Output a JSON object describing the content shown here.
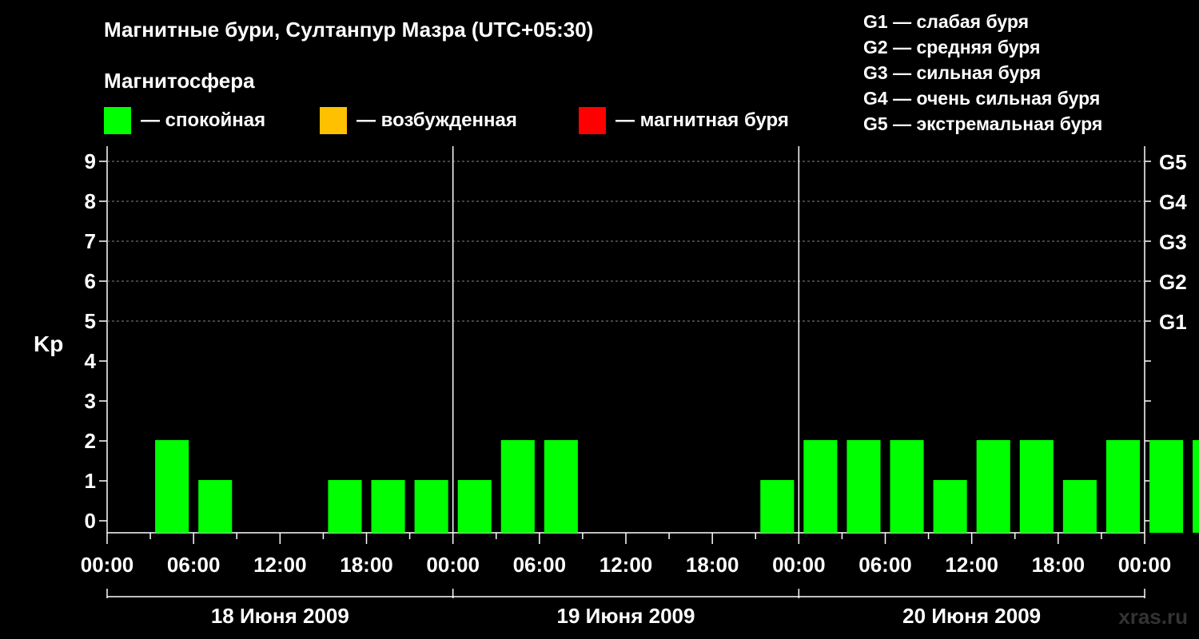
{
  "title": "Магнитные бури, Султанпур Мазра (UTC+05:30)",
  "subtitle": "Магнитосфера",
  "legend": [
    {
      "label": "— спокойная",
      "color": "#00ff00"
    },
    {
      "label": "— возбужденная",
      "color": "#ffc000"
    },
    {
      "label": "— магнитная буря",
      "color": "#ff0000"
    }
  ],
  "g_legend": [
    "G1 — слабая буря",
    "G2 — средняя буря",
    "G3 — сильная буря",
    "G4 — очень сильная буря",
    "G5 — экстремальная буря"
  ],
  "watermark": "xras.ru",
  "chart_data": {
    "type": "bar",
    "ylabel": "Kp",
    "ylim": [
      0,
      9
    ],
    "yticks": [
      "0",
      "1",
      "2",
      "3",
      "4",
      "5",
      "6",
      "7",
      "8",
      "9"
    ],
    "right_ticks": [
      {
        "level": 5,
        "label": "G1"
      },
      {
        "level": 6,
        "label": "G2"
      },
      {
        "level": 7,
        "label": "G3"
      },
      {
        "level": 8,
        "label": "G4"
      },
      {
        "level": 9,
        "label": "G5"
      }
    ],
    "xtick_labels": [
      "00:00",
      "06:00",
      "12:00",
      "18:00",
      "00:00",
      "06:00",
      "12:00",
      "18:00",
      "00:00",
      "06:00",
      "12:00",
      "18:00",
      "00:00"
    ],
    "days": [
      "18 Июня 2009",
      "19 Июня 2009",
      "20 Июня 2009"
    ],
    "interval_hours": 3,
    "start": "18 Июня 2009 00:00",
    "series": [
      {
        "values": [
          0,
          2,
          1,
          0,
          0,
          1,
          1,
          1,
          1,
          2,
          2,
          0,
          0,
          0,
          0,
          1,
          2,
          2,
          2,
          1,
          2,
          2,
          1,
          2,
          2,
          2
        ],
        "color": "#00ff00"
      }
    ],
    "last_bar_partial": true,
    "grid": true
  }
}
